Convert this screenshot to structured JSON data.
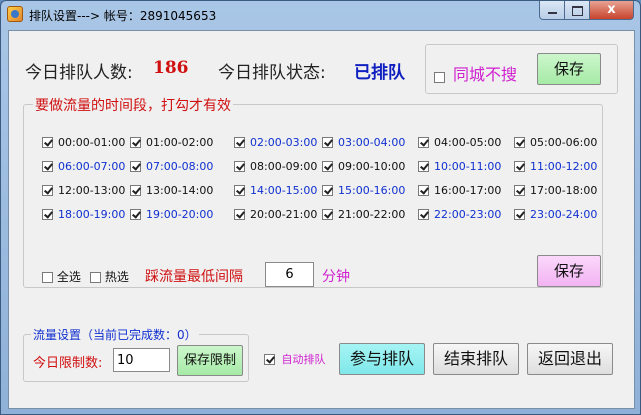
{
  "window": {
    "title": "排队设置---> 帐号：2891045653",
    "close_label": "x"
  },
  "stats": {
    "count_label": "今日排队人数:",
    "count_value": "186",
    "status_label": "今日排队状态:",
    "status_value": "已排队"
  },
  "same_city": {
    "label": "同城不搜",
    "checked": false,
    "save_label": "保存"
  },
  "time_slots": {
    "legend": "要做流量的时间段，打勾才有效",
    "slots": [
      {
        "label": "00:00-01:00",
        "checked": true,
        "color": "black"
      },
      {
        "label": "01:00-02:00",
        "checked": true,
        "color": "black"
      },
      {
        "label": "02:00-03:00",
        "checked": true,
        "color": "blue"
      },
      {
        "label": "03:00-04:00",
        "checked": true,
        "color": "blue"
      },
      {
        "label": "04:00-05:00",
        "checked": true,
        "color": "black"
      },
      {
        "label": "05:00-06:00",
        "checked": true,
        "color": "black"
      },
      {
        "label": "06:00-07:00",
        "checked": true,
        "color": "blue"
      },
      {
        "label": "07:00-08:00",
        "checked": true,
        "color": "blue"
      },
      {
        "label": "08:00-09:00",
        "checked": true,
        "color": "black"
      },
      {
        "label": "09:00-10:00",
        "checked": true,
        "color": "black"
      },
      {
        "label": "10:00-11:00",
        "checked": true,
        "color": "blue"
      },
      {
        "label": "11:00-12:00",
        "checked": true,
        "color": "blue"
      },
      {
        "label": "12:00-13:00",
        "checked": true,
        "color": "black"
      },
      {
        "label": "13:00-14:00",
        "checked": true,
        "color": "black"
      },
      {
        "label": "14:00-15:00",
        "checked": true,
        "color": "blue"
      },
      {
        "label": "15:00-16:00",
        "checked": true,
        "color": "blue"
      },
      {
        "label": "16:00-17:00",
        "checked": true,
        "color": "black"
      },
      {
        "label": "17:00-18:00",
        "checked": true,
        "color": "black"
      },
      {
        "label": "18:00-19:00",
        "checked": true,
        "color": "blue"
      },
      {
        "label": "19:00-20:00",
        "checked": true,
        "color": "blue"
      },
      {
        "label": "20:00-21:00",
        "checked": true,
        "color": "black"
      },
      {
        "label": "21:00-22:00",
        "checked": true,
        "color": "black"
      },
      {
        "label": "22:00-23:00",
        "checked": true,
        "color": "blue"
      },
      {
        "label": "23:00-24:00",
        "checked": true,
        "color": "blue"
      }
    ],
    "select_all_label": "全选",
    "select_all_checked": false,
    "hot_select_label": "热选",
    "hot_select_checked": false,
    "interval_label": "踩流量最低间隔",
    "interval_value": "6",
    "interval_unit": "分钟",
    "save_label": "保存"
  },
  "flow": {
    "legend": "流量设置（当前已完成数：0）",
    "limit_label": "今日限制数:",
    "limit_value": "10",
    "save_limit_label": "保存限制"
  },
  "actions": {
    "auto_queue_label": "自动排队",
    "auto_queue_checked": true,
    "join_label": "参与排队",
    "end_label": "结束排队",
    "exit_label": "返回退出"
  },
  "colors": {
    "red_text": "#d01010",
    "blue_text": "#1030d0",
    "magenta_text": "#d020d0",
    "green_button": "#a6eaa6",
    "pink_button": "#f2b3f2",
    "cyan_button": "#7fe8ea"
  }
}
